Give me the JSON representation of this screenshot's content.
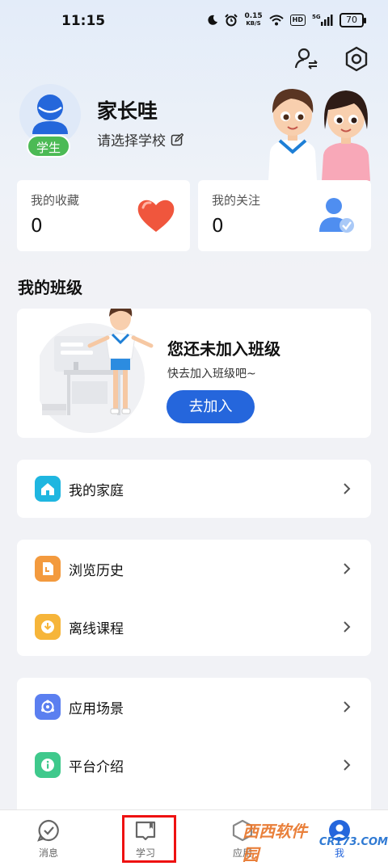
{
  "status_bar": {
    "time": "11:15",
    "network_speed_value": "0.15",
    "network_speed_unit": "KB/S",
    "hd_label": "HD",
    "signal_label": "5G",
    "battery": "70",
    "icons": [
      "moon-icon",
      "alarm-icon",
      "wifi-icon",
      "signal-icon",
      "battery-icon"
    ]
  },
  "top_actions": {
    "icons": [
      "switch-user-icon",
      "settings-icon"
    ]
  },
  "profile": {
    "name": "家长哇",
    "school_placeholder": "请选择学校",
    "role_badge": "学生"
  },
  "stats": [
    {
      "label": "我的收藏",
      "value": "0",
      "icon": "heart-icon"
    },
    {
      "label": "我的关注",
      "value": "0",
      "icon": "follow-user-icon"
    }
  ],
  "class_section": {
    "title": "我的班级",
    "empty_title": "您还未加入班级",
    "empty_subtitle": "快去加入班级吧~",
    "join_label": "去加入"
  },
  "menu_groups": [
    {
      "items": [
        {
          "label": "我的家庭",
          "icon": "home-icon",
          "color": "#1fb6e0"
        }
      ]
    },
    {
      "items": [
        {
          "label": "浏览历史",
          "icon": "history-icon",
          "color": "#f39a3e"
        },
        {
          "label": "离线课程",
          "icon": "download-icon",
          "color": "#f6b53a"
        }
      ]
    },
    {
      "items": [
        {
          "label": "应用场景",
          "icon": "scene-icon",
          "color": "#5b7ff0"
        },
        {
          "label": "平台介绍",
          "icon": "info-icon",
          "color": "#3fc98c"
        }
      ]
    }
  ],
  "bottom_nav": {
    "items": [
      {
        "label": "消息",
        "icon": "message-icon"
      },
      {
        "label": "学习",
        "icon": "book-icon"
      },
      {
        "label": "应用",
        "icon": "apps-icon"
      },
      {
        "label": "我",
        "icon": "me-icon"
      }
    ],
    "active_color": "#2566dc"
  },
  "watermark": {
    "main": "西西软件园",
    "sub": "CR173.COM"
  }
}
